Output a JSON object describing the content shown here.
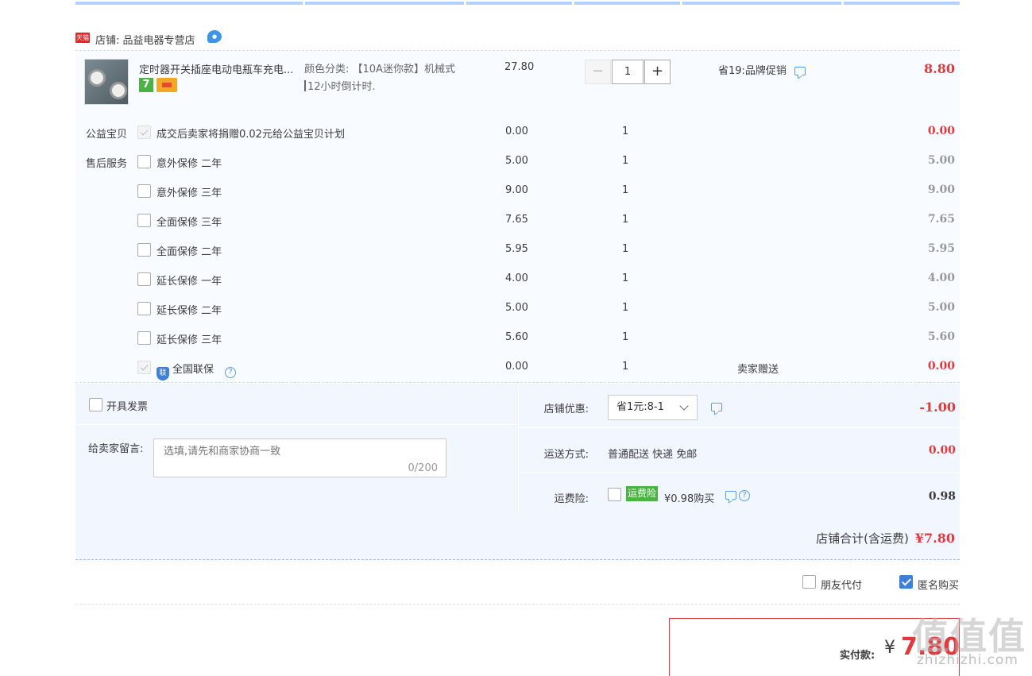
{
  "shop": {
    "badge": "天猫",
    "label": "店铺: 品益电器专营店",
    "ww_icon": "wangwang-chat-icon"
  },
  "item": {
    "title": "定时器开关插座电动电瓶车充电...",
    "sku_line1": "颜色分类: 【10A迷你款】机械式",
    "sku_line2": "12小时倒计时.",
    "unit_price": "27.80",
    "qty": "1",
    "qty_minus": "−",
    "qty_plus": "+",
    "promo": "省19:品牌促销",
    "subtotal": "8.80",
    "badge_seven": "7"
  },
  "services": [
    {
      "group": "公益宝贝",
      "name": "成交后卖家将捐赠0.02元给公益宝贝计划",
      "price": "0.00",
      "qty": "1",
      "note": "",
      "total": "0.00",
      "checked": "disabled"
    },
    {
      "group": "售后服务",
      "name": "意外保修 二年",
      "price": "5.00",
      "qty": "1",
      "note": "",
      "total": "5.00",
      "checked": "no"
    },
    {
      "group": "",
      "name": "意外保修 三年",
      "price": "9.00",
      "qty": "1",
      "note": "",
      "total": "9.00",
      "checked": "no"
    },
    {
      "group": "",
      "name": "全面保修 三年",
      "price": "7.65",
      "qty": "1",
      "note": "",
      "total": "7.65",
      "checked": "no"
    },
    {
      "group": "",
      "name": "全面保修 二年",
      "price": "5.95",
      "qty": "1",
      "note": "",
      "total": "5.95",
      "checked": "no"
    },
    {
      "group": "",
      "name": "延长保修 一年",
      "price": "4.00",
      "qty": "1",
      "note": "",
      "total": "4.00",
      "checked": "no"
    },
    {
      "group": "",
      "name": "延长保修 二年",
      "price": "5.00",
      "qty": "1",
      "note": "",
      "total": "5.00",
      "checked": "no"
    },
    {
      "group": "",
      "name": "延长保修 三年",
      "price": "5.60",
      "qty": "1",
      "note": "",
      "total": "5.60",
      "checked": "no"
    },
    {
      "group": "",
      "name": "全国联保",
      "price": "0.00",
      "qty": "1",
      "note": "卖家赠送",
      "total": "0.00",
      "checked": "disabled"
    }
  ],
  "invoice": {
    "label": "开具发票"
  },
  "message": {
    "label": "给卖家留言:",
    "placeholder": "选填,请先和商家协商一致",
    "counter": "0/200"
  },
  "discount": {
    "label": "店铺优惠:",
    "selected": "省1元:8-1",
    "amount": "-1.00"
  },
  "shipping": {
    "label": "运送方式:",
    "value": "普通配送 快递 免邮",
    "amount": "0.00"
  },
  "insurance": {
    "label": "运费险:",
    "tag": "运费险",
    "value": "¥0.98购买",
    "amount": "0.98"
  },
  "shop_total": {
    "label": "店铺合计(含运费)",
    "amount": "¥7.80"
  },
  "options": {
    "friend_pay": "朋友代付",
    "anonymous": "匿名购买"
  },
  "payment": {
    "label": "实付款:",
    "currency": "¥",
    "amount": "7.80"
  },
  "watermark": {
    "chars": [
      "值",
      "值",
      "值"
    ],
    "url": "zhizhizhi.com"
  },
  "colors": {
    "price_red": "#e4393c",
    "accent_blue": "#3d7fd9",
    "bg_light": "#f8fbff"
  }
}
